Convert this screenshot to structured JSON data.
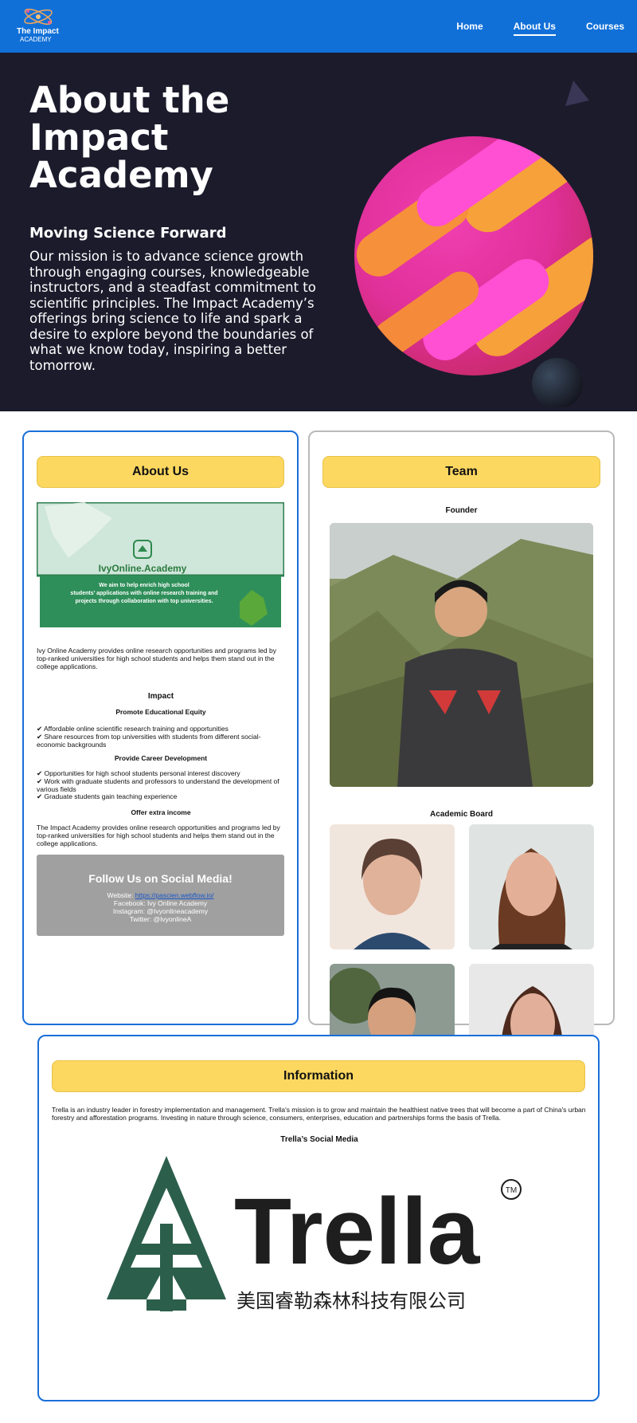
{
  "nav": {
    "logo_line1": "The Impact",
    "logo_line2": "ACADEMY",
    "links": [
      "Home",
      "About Us",
      "Courses"
    ],
    "active": "About Us"
  },
  "hero": {
    "title": "About the Impact Academy",
    "subtitle": "Moving Science Forward",
    "text": "Our mission is to advance science growth through engaging courses, knowledgeable instructors, and a steadfast commitment to scientific principles. The Impact Academy’s offerings bring science to life and spark a desire to explore beyond the boundaries of what we know today, inspiring a better tomorrow."
  },
  "about": {
    "heading": "About Us",
    "banner_brand": "IvyOnline.Academy",
    "banner_text": "We aim to help enrich high school students’ applications with online research training and projects through collaboration with top universities.",
    "intro": "Ivy Online Academy provides online research opportunities and programs led by top-ranked universities for high school students and helps them stand out in the college applications.",
    "impact_heading": "Impact",
    "equity_heading": "Promote Educational Equity",
    "equity_items": [
      "✔ Affordable online scientific research training and opportunities",
      "✔ Share resources from top universities with students from different social-economic backgrounds"
    ],
    "career_heading": "Provide Career Development",
    "career_items": [
      "✔ Opportunities for high school students personal interest discovery",
      "✔ Work with graduate students and professors to understand the development of various fields",
      "✔ Graduate students gain teaching experience"
    ],
    "income_heading": "Offer extra income",
    "income_text": "The Impact Academy provides online research opportunities and programs led by top-ranked universities for high school students and helps them stand out in the college applications.",
    "follow": {
      "title": "Follow Us on Social Media!",
      "website_label": "Website: ",
      "website_url": "https://pascien.webflow.io/",
      "facebook": "Facebook: Ivy Online Academy",
      "instagram": "Instagram: @Ivyonlineacademy",
      "twitter": "Twitter: @IvyonlineA"
    }
  },
  "team": {
    "heading": "Team",
    "founder_label": "Founder",
    "board_label": "Academic Board"
  },
  "info": {
    "heading": "Information",
    "text": "Trella is an industry leader in forestry implementation and management. Trella's mission is to grow and maintain the healthiest native trees that will become a part of China's urban forestry and afforestation programs. Investing in nature through science, consumers, enterprises, education and partnerships forms the basis of Trella.",
    "social_heading": "Trella’s Social Media",
    "logo_word": "Trella",
    "logo_tm": "TM",
    "logo_chinese": "美国睿勒森林科技有限公司"
  },
  "colors": {
    "nav": "#1170d8",
    "hero_bg": "#1c1b2c",
    "pill": "#fcd860",
    "card_border": "#1a6fd8",
    "trella_green": "#2c5e4c"
  }
}
